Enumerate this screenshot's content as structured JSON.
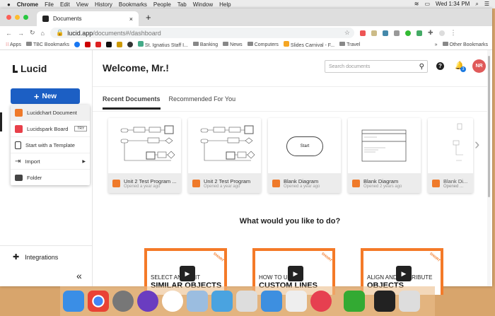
{
  "menubar": {
    "app": "Chrome",
    "items": [
      "File",
      "Edit",
      "View",
      "History",
      "Bookmarks",
      "People",
      "Tab",
      "Window",
      "Help"
    ],
    "clock": "Wed 1:34 PM"
  },
  "browser": {
    "tab_title": "Documents",
    "url_host": "lucid.app",
    "url_path": "/documents#/dashboard",
    "bookmarks": [
      "Apps",
      "TBC Bookmarks",
      "St. Ignatius Staff I...",
      "Banking",
      "News",
      "Computers",
      "Slides Carnival - F...",
      "Travel",
      "Other Bookmarks"
    ]
  },
  "sidebar": {
    "logo": "Lucid",
    "new_label": "New",
    "menu": [
      {
        "label": "Lucidchart Document",
        "icon": "lucidchart-icon"
      },
      {
        "label": "Lucidspark Board",
        "icon": "lucidspark-icon",
        "badge": "TRY"
      },
      {
        "label": "Start with a Template",
        "icon": "template-icon"
      },
      {
        "label": "Import",
        "icon": "import-icon"
      },
      {
        "label": "Folder",
        "icon": "folder-icon"
      }
    ],
    "integrations": "Integrations",
    "collapse": "«"
  },
  "header": {
    "welcome": "Welcome, Mr.!",
    "search_placeholder": "Search documents",
    "notifications": "3",
    "avatar": "NR"
  },
  "tabs": [
    "Recent Documents",
    "Recommended For You"
  ],
  "documents": [
    {
      "title": "Unit 2 Test Program ...",
      "sub": "Opened a year ago"
    },
    {
      "title": "Unit 2 Test Program",
      "sub": "Opened a year ago"
    },
    {
      "title": "Blank Diagram",
      "sub": "Opened a year ago",
      "thumb_text": "Start"
    },
    {
      "title": "Blank Diagram",
      "sub": "Opened 2 years ago"
    },
    {
      "title": "Blank Di...",
      "sub": "Opened ..."
    }
  ],
  "what_title": "What would you like to do?",
  "videos": [
    {
      "line1": "SELECT AND EDIT",
      "line2": "SIMILAR OBJECTS",
      "tag": "SHORT"
    },
    {
      "line1": "HOW TO USE",
      "line2": "CUSTOM LINES",
      "tag": "SHORT"
    },
    {
      "line1": "ALIGN AND DISTRIBUTE",
      "line2": "OBJECTS",
      "tag": "SHORT"
    }
  ],
  "colors": {
    "accent": "#1c5fc4",
    "lucidchart": "#ef7a2a",
    "lucidspark": "#e8404a",
    "avatar": "#e05a5a"
  }
}
